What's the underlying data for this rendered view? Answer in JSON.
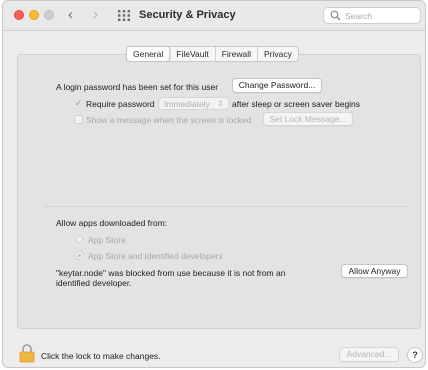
{
  "window": {
    "title": "Security & Privacy",
    "back_label": "‹",
    "forward_label": "›",
    "grid_icon": "show-all-grid-icon"
  },
  "search": {
    "placeholder": "Search"
  },
  "tabs": [
    {
      "label": "General",
      "active": true
    },
    {
      "label": "FileVault",
      "active": false
    },
    {
      "label": "Firewall",
      "active": false
    },
    {
      "label": "Privacy",
      "active": false
    }
  ],
  "general": {
    "login_text": "A login password has been set for this user",
    "change_password_label": "Change Password...",
    "require_password_label": "Require password",
    "require_password_checked": true,
    "require_password_value": "Immediately",
    "after_sleep_text": "after sleep or screen saver begins",
    "show_message_label": "Show a message when the screen is locked",
    "show_message_checked": false,
    "set_lock_message_label": "Set Lock Message..."
  },
  "allow": {
    "heading": "Allow apps downloaded from:",
    "options": [
      {
        "label": "App Store",
        "selected": false
      },
      {
        "label": "App Store and identified developers",
        "selected": true
      }
    ],
    "blocked_line1": "\"keytar.node\" was blocked from use because it is not from an",
    "blocked_line2": "identified developer.",
    "allow_anyway_label": "Allow Anyway"
  },
  "footer": {
    "lock_text": "Click the lock to make changes.",
    "advanced_label": "Advanced...",
    "help_label": "?"
  },
  "colors": {
    "close": "#fe5f57",
    "minimize": "#febc2e",
    "zoom_inactive": "#cfcfcf",
    "lock_body": "#f2b441"
  }
}
